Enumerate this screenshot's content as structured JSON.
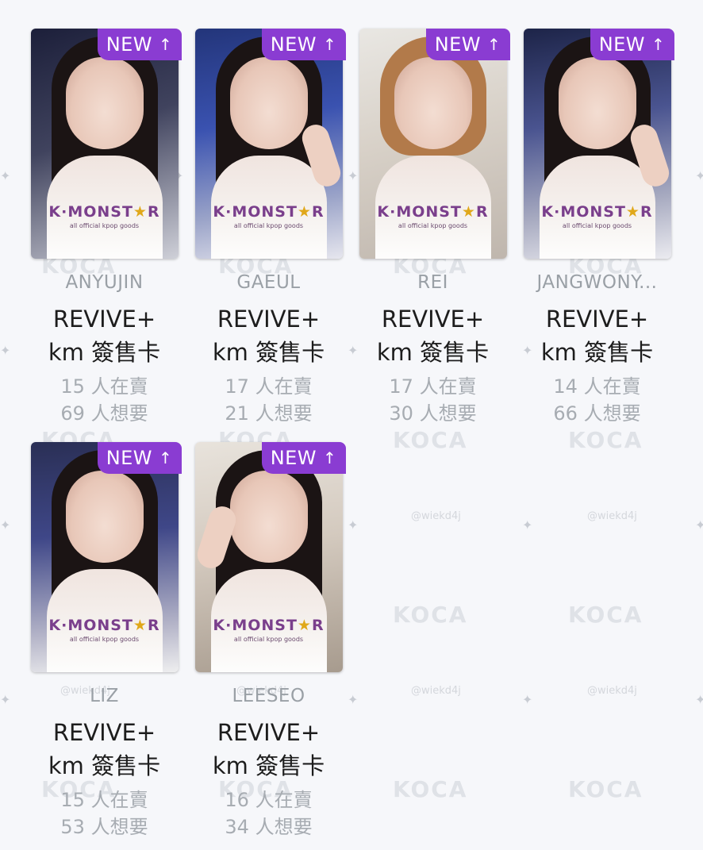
{
  "colors": {
    "badge_bg": "#8a3cd2",
    "page_bg": "#f6f7fa",
    "member_text": "#9aa0a6",
    "title_text": "#1d1d1d",
    "stat_text": "#a7acb2"
  },
  "watermark": {
    "brand": "KOCA",
    "handle": "@wiekd4j"
  },
  "cards": [
    {
      "badge": "NEW",
      "badge_icon": "arrow-up-icon",
      "logo": "K·MONST★R",
      "logo_sub": "all official kpop goods",
      "member": "ANYUJIN",
      "title_line1": "REVIVE+",
      "title_line2": "km 簽售卡",
      "sellers": "15 人在賣",
      "wanters": "69 人想要"
    },
    {
      "badge": "NEW",
      "badge_icon": "arrow-up-icon",
      "logo": "K·MONST★R",
      "logo_sub": "all official kpop goods",
      "member": "GAEUL",
      "title_line1": "REVIVE+",
      "title_line2": "km 簽售卡",
      "sellers": "17 人在賣",
      "wanters": "21 人想要"
    },
    {
      "badge": "NEW",
      "badge_icon": "arrow-up-icon",
      "logo": "K·MONST★R",
      "logo_sub": "all official kpop goods",
      "member": "REI",
      "title_line1": "REVIVE+",
      "title_line2": "km 簽售卡",
      "sellers": "17 人在賣",
      "wanters": "30 人想要"
    },
    {
      "badge": "NEW",
      "badge_icon": "arrow-up-icon",
      "logo": "K·MONST★R",
      "logo_sub": "all official kpop goods",
      "member": "JANGWONY...",
      "title_line1": "REVIVE+",
      "title_line2": "km 簽售卡",
      "sellers": "14 人在賣",
      "wanters": "66 人想要"
    },
    {
      "badge": "NEW",
      "badge_icon": "arrow-up-icon",
      "logo": "K·MONST★R",
      "logo_sub": "all official kpop goods",
      "member": "LIZ",
      "title_line1": "REVIVE+",
      "title_line2": "km 簽售卡",
      "sellers": "15 人在賣",
      "wanters": "53 人想要"
    },
    {
      "badge": "NEW",
      "badge_icon": "arrow-up-icon",
      "logo": "K·MONST★R",
      "logo_sub": "all official kpop goods",
      "member": "LEESEO",
      "title_line1": "REVIVE+",
      "title_line2": "km 簽售卡",
      "sellers": "16 人在賣",
      "wanters": "34 人想要"
    }
  ]
}
